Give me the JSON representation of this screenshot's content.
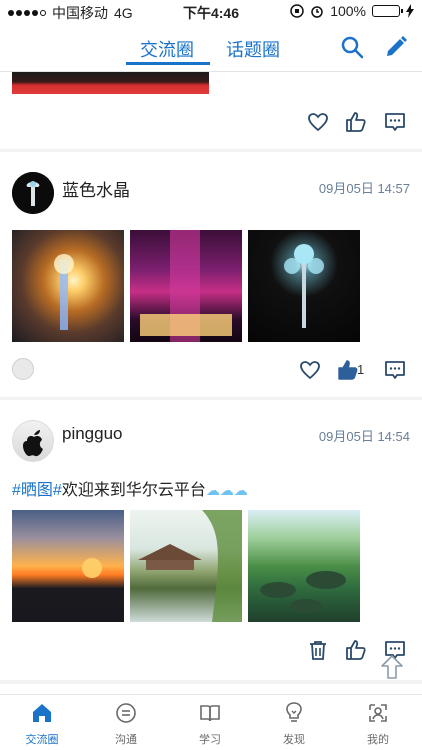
{
  "status_bar": {
    "carrier": "中国移动",
    "network": "4G",
    "time": "下午4:46",
    "battery": "100%"
  },
  "nav": {
    "tabs": [
      {
        "label": "交流圈",
        "active": true
      },
      {
        "label": "话题圈",
        "active": false
      }
    ],
    "search_icon": "search-icon",
    "edit_icon": "edit-icon"
  },
  "posts": [
    {
      "username": "蓝色水晶",
      "time": "09月05日 14:57",
      "likes": "1"
    },
    {
      "username": "pingguo",
      "time": "09月05日 14:54",
      "text": {
        "tag": "#晒图#",
        "body": "欢迎来到华尔云平台"
      }
    }
  ],
  "tab_bar": [
    {
      "label": "交流圈",
      "icon": "home-icon",
      "active": true
    },
    {
      "label": "沟通",
      "icon": "chat-icon",
      "active": false
    },
    {
      "label": "学习",
      "icon": "book-icon",
      "active": false
    },
    {
      "label": "发现",
      "icon": "bulb-icon",
      "active": false
    },
    {
      "label": "我的",
      "icon": "profile-icon",
      "active": false
    }
  ],
  "colors": {
    "accent": "#1a73c9",
    "muted": "#6a7f99"
  }
}
